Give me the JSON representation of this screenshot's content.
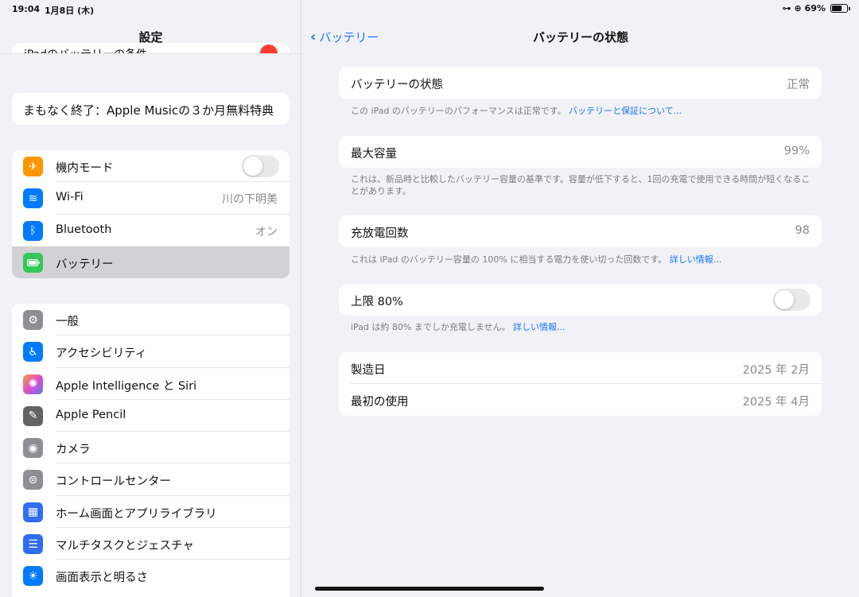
{
  "status": {
    "time": "19:04",
    "date": "1月8日 (木)",
    "battery_percent": "69%"
  },
  "sidebar": {
    "title": "設定",
    "partial_item": "iPadのバッテリーの条件",
    "promo": "まもなく終了：Apple Musicの３か月無料特典",
    "group1": [
      {
        "label": "機内モード",
        "icon": "airplane-icon",
        "color": "#ff9500",
        "glyph": "✈",
        "toggle": false
      },
      {
        "label": "Wi-Fi",
        "icon": "wifi-icon",
        "color": "#007aff",
        "glyph": "≋",
        "value": "川の下明美"
      },
      {
        "label": "Bluetooth",
        "icon": "bluetooth-icon",
        "color": "#007aff",
        "glyph": "ᛒ",
        "value": "オン"
      },
      {
        "label": "バッテリー",
        "icon": "battery-icon",
        "color": "#34c759",
        "glyph": "▭",
        "selected": true
      }
    ],
    "group2": [
      {
        "label": "一般",
        "icon": "gear-icon",
        "color": "#8e8e93",
        "glyph": "⚙"
      },
      {
        "label": "アクセシビリティ",
        "icon": "accessibility-icon",
        "color": "#007aff",
        "glyph": "♿"
      },
      {
        "label": "Apple Intelligence と Siri",
        "icon": "siri-icon",
        "color": "#d05ad8",
        "glyph": "✺"
      },
      {
        "label": "Apple Pencil",
        "icon": "pencil-icon",
        "color": "#636366",
        "glyph": "✎"
      },
      {
        "label": "カメラ",
        "icon": "camera-icon",
        "color": "#8e8e93",
        "glyph": "◉"
      },
      {
        "label": "コントロールセンター",
        "icon": "control-center-icon",
        "color": "#8e8e93",
        "glyph": "⊜"
      },
      {
        "label": "ホーム画面とアプリライブラリ",
        "icon": "home-screen-icon",
        "color": "#2f6df6",
        "glyph": "▦"
      },
      {
        "label": "マルチタスクとジェスチャ",
        "icon": "multitasking-icon",
        "color": "#2f6df6",
        "glyph": "☰"
      },
      {
        "label": "画面表示と明るさ",
        "icon": "brightness-icon",
        "color": "#007aff",
        "glyph": "☀"
      }
    ]
  },
  "main": {
    "back_label": "バッテリー",
    "title": "バッテリーの状態",
    "health": {
      "label": "バッテリーの状態",
      "value": "正常",
      "footer": "この iPad のバッテリーのパフォーマンスは正常です。",
      "footer_link": "バッテリーと保証について..."
    },
    "capacity": {
      "label": "最大容量",
      "value": "99%",
      "footer": "これは、新品時と比較したバッテリー容量の基準です。容量が低下すると、1回の充電で使用できる時間が短くなることがあります。"
    },
    "cycles": {
      "label": "充放電回数",
      "value": "98",
      "footer": "これは iPad のバッテリー容量の 100% に相当する電力を使い切った回数です。",
      "footer_link": "詳しい情報..."
    },
    "limit": {
      "label": "上限 80%",
      "toggle": false,
      "footer": "iPad は約 80% までしか充電しません。",
      "footer_link": "詳しい情報..."
    },
    "dates": [
      {
        "label": "製造日",
        "value": "2025 年 2月"
      },
      {
        "label": "最初の使用",
        "value": "2025 年 4月"
      }
    ]
  },
  "colors": {
    "accent": "#1677ff",
    "background": "#f2f1f6",
    "selected_row": "#d1d1d6"
  }
}
